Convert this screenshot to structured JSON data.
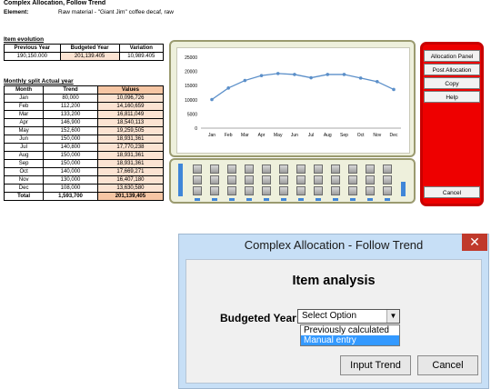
{
  "header": {
    "title": "Complex Allocation, Follow Trend",
    "element_label": "Element:",
    "element_value": "Raw material - \"Giant Jim\" coffee decaf, raw"
  },
  "item_evolution": {
    "label": "Item evolution",
    "columns": [
      "Previous Year",
      "Budgeted Year",
      "Variation"
    ],
    "values": [
      "190,150.000",
      "201,139.405",
      "10,989.405"
    ]
  },
  "monthly": {
    "label": "Monthly split Actual year",
    "columns": [
      "Month",
      "Trend",
      "Values"
    ],
    "rows": [
      [
        "Jan",
        "80,000",
        "10,096,726"
      ],
      [
        "Feb",
        "112,200",
        "14,160,659"
      ],
      [
        "Mar",
        "133,200",
        "16,811,049"
      ],
      [
        "Apr",
        "146,900",
        "18,540,113"
      ],
      [
        "May",
        "152,600",
        "19,259,505"
      ],
      [
        "Jun",
        "150,000",
        "18,931,361"
      ],
      [
        "Jul",
        "140,800",
        "17,770,238"
      ],
      [
        "Aug",
        "150,000",
        "18,931,361"
      ],
      [
        "Sep",
        "150,000",
        "18,931,361"
      ],
      [
        "Oct",
        "140,000",
        "17,669,271"
      ],
      [
        "Nov",
        "130,000",
        "16,407,180"
      ],
      [
        "Dec",
        "108,000",
        "13,630,580"
      ]
    ],
    "total": [
      "Total",
      "1,593,700",
      "201,139,405"
    ]
  },
  "chart_data": {
    "type": "line",
    "categories": [
      "Jan",
      "Feb",
      "Mar",
      "Apr",
      "May",
      "Jun",
      "Jul",
      "Aug",
      "Sep",
      "Oct",
      "Nov",
      "Dec"
    ],
    "values": [
      10097,
      14161,
      16811,
      18540,
      19260,
      18931,
      17770,
      18931,
      18931,
      17669,
      16407,
      13631
    ],
    "y_ticks": [
      "25000",
      "20000",
      "15000",
      "10000",
      "5000",
      "0"
    ],
    "ylim": [
      0,
      25000
    ],
    "grid": false,
    "line_color": "#5b8fc9"
  },
  "slider_panel": {
    "level_left": 1.0,
    "level_right": 0.45,
    "color": "#3f86d8"
  },
  "action_panel": {
    "buttons": [
      "Allocation Panel",
      "Post Allocation",
      "Copy",
      "Help"
    ],
    "cancel": "Cancel"
  },
  "dialog": {
    "title": "Complex Allocation - Follow Trend",
    "close_glyph": "✕",
    "heading": "Item analysis",
    "field_label": "Budgeted Year:",
    "select_value": "Select Option",
    "options": [
      "Previously calculated",
      "Manual entry"
    ],
    "highlighted_option": 1,
    "input_trend": "Input Trend",
    "cancel": "Cancel"
  }
}
